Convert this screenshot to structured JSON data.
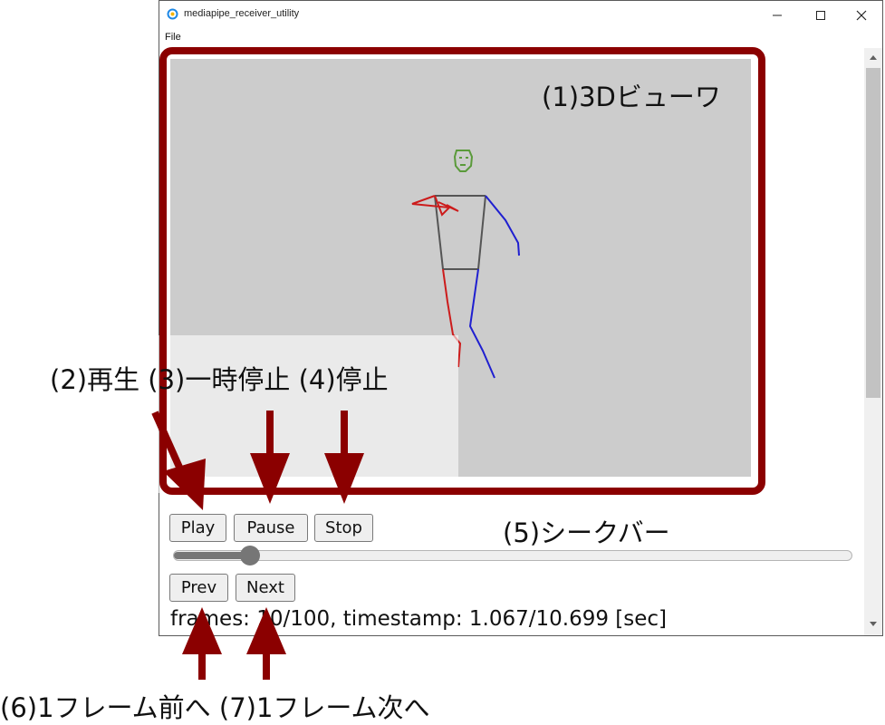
{
  "window": {
    "title": "mediapipe_receiver_utility",
    "menu": [
      "File"
    ]
  },
  "viewer": {
    "background": "#cccccc"
  },
  "controls": {
    "play_label": "Play",
    "pause_label": "Pause",
    "stop_label": "Stop",
    "prev_label": "Prev",
    "next_label": "Next"
  },
  "seekbar": {
    "value_fraction": 0.1
  },
  "status": {
    "text": "frames: 10/100, timestamp: 1.067/10.699 [sec]"
  },
  "annotations": {
    "viewer": "(1)3Dビューワ",
    "play_pause_stop": "(2)再生 (3)一時停止 (4)停止",
    "seekbar": "(5)シークバー",
    "prev_next": "(6)1フレーム前へ (7)1フレーム次へ",
    "highlight_color": "#8b0000"
  },
  "colors": {
    "head": "#5a9a3a",
    "torso": "#555555",
    "right_side": "#cc1b1b",
    "left_side": "#1f1fd0"
  }
}
